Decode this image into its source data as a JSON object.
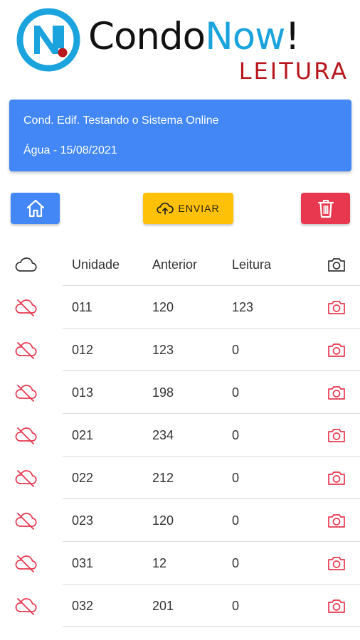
{
  "logo": {
    "word_part1": "Condo",
    "word_part2": "Now",
    "word_part3": "!",
    "subtitle": "LEITURA",
    "colors": {
      "blue": "#1ba3dd",
      "red": "#b8161d",
      "dark": "#111111"
    }
  },
  "info": {
    "condo_name": "Cond. Edif. Testando o Sistema Online",
    "reading_label": "Água - 15/08/2021"
  },
  "actions": {
    "home_icon": "home-icon",
    "send_label": "ENVIAR",
    "send_icon": "cloud-upload-icon",
    "delete_icon": "trash-icon"
  },
  "table": {
    "headers": {
      "status_icon": "cloud-icon",
      "unit": "Unidade",
      "previous": "Anterior",
      "reading": "Leitura",
      "photo_icon": "camera-icon"
    },
    "rows": [
      {
        "unit": "011",
        "previous": "120",
        "reading": "123",
        "status_icon": "cloud-off-icon"
      },
      {
        "unit": "012",
        "previous": "123",
        "reading": "0",
        "status_icon": "cloud-off-icon"
      },
      {
        "unit": "013",
        "previous": "198",
        "reading": "0",
        "status_icon": "cloud-off-icon"
      },
      {
        "unit": "021",
        "previous": "234",
        "reading": "0",
        "status_icon": "cloud-off-icon"
      },
      {
        "unit": "022",
        "previous": "212",
        "reading": "0",
        "status_icon": "cloud-off-icon"
      },
      {
        "unit": "023",
        "previous": "120",
        "reading": "0",
        "status_icon": "cloud-off-icon"
      },
      {
        "unit": "031",
        "previous": "12",
        "reading": "0",
        "status_icon": "cloud-off-icon"
      },
      {
        "unit": "032",
        "previous": "201",
        "reading": "0",
        "status_icon": "cloud-off-icon"
      }
    ]
  },
  "colors": {
    "primary": "#4287f5",
    "warning": "#ffc107",
    "danger": "#e8384f",
    "icon_red": "#e8384f"
  }
}
